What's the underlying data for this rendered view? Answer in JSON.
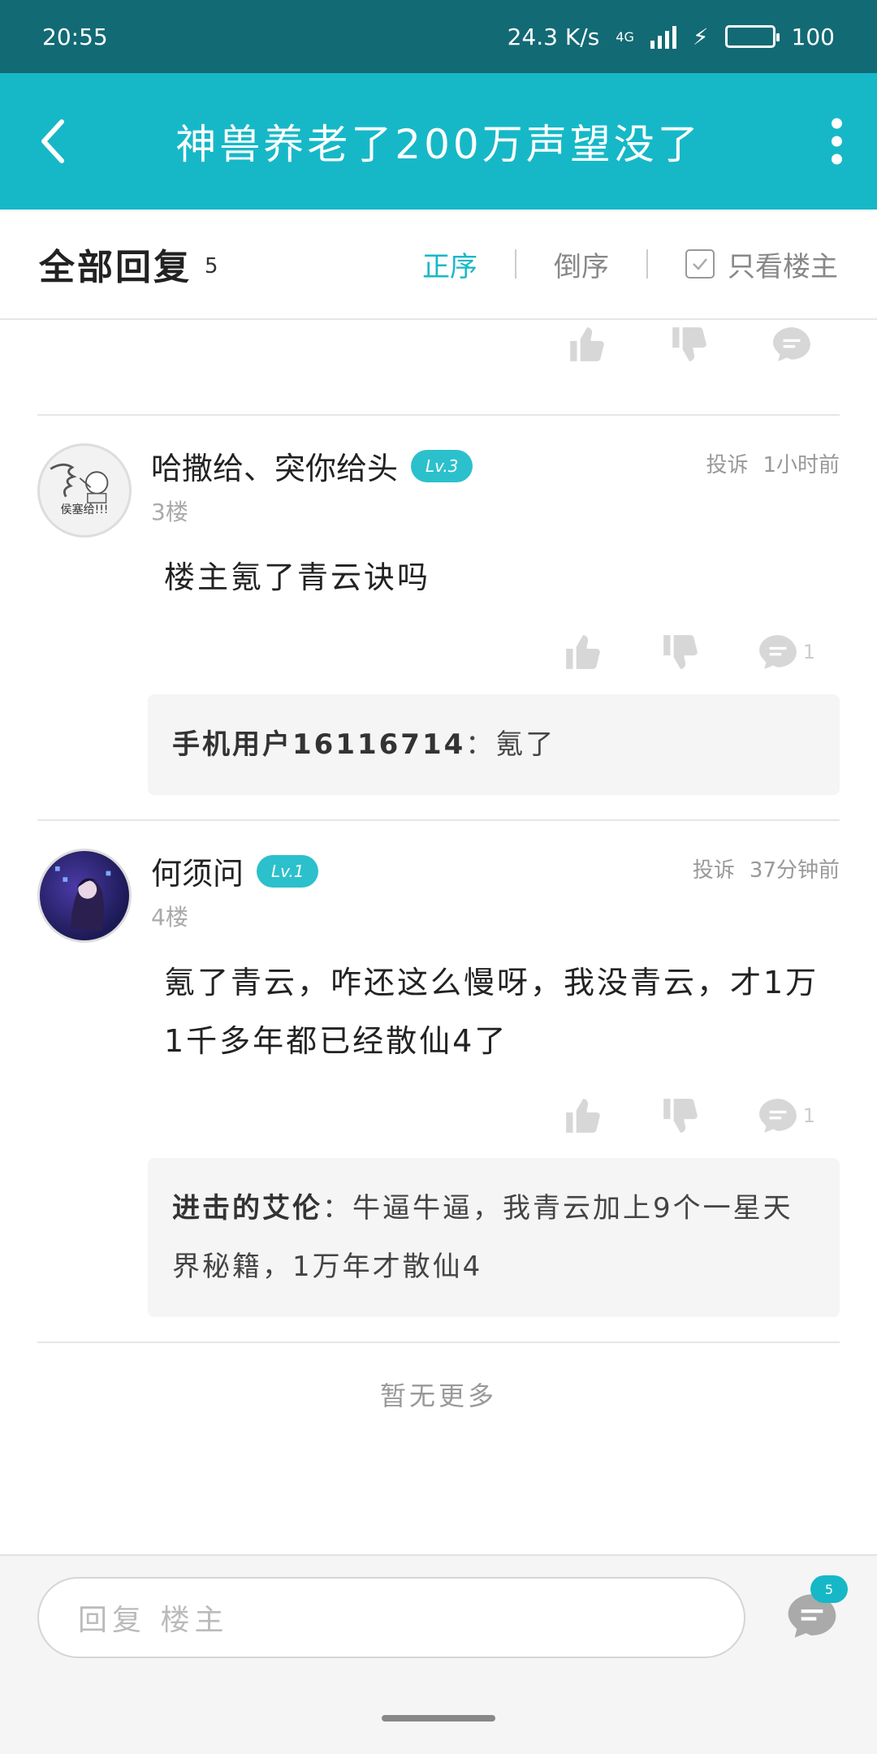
{
  "status_bar": {
    "time": "20:55",
    "net_speed": "24.3 K/s",
    "network": "4G",
    "battery": "100"
  },
  "header": {
    "title": "神兽养老了200万声望没了"
  },
  "filter": {
    "title": "全部回复",
    "count": "5",
    "sort_asc": "正序",
    "sort_desc": "倒序",
    "only_op": "只看楼主"
  },
  "posts": [
    {
      "username": "哈撒给、突你给头",
      "level": "Lv.3",
      "floor": "3楼",
      "report": "投诉",
      "time": "1小时前",
      "avatar_caption": "侯塞给!!!",
      "body": "楼主氪了青云诀吗",
      "comment_count": "1",
      "reply_user": "手机用户16116714",
      "reply_text": "：氪了"
    },
    {
      "username": "何须问",
      "level": "Lv.1",
      "floor": "4楼",
      "report": "投诉",
      "time": "37分钟前",
      "body": "氪了青云，咋还这么慢呀，我没青云，才1万1千多年都已经散仙4了",
      "comment_count": "1",
      "reply_user": "进击的艾伦",
      "reply_text": "：牛逼牛逼，我青云加上9个一星天界秘籍，1万年才散仙4"
    }
  ],
  "footer_text": "暂无更多",
  "bottom": {
    "reply_placeholder": "回复 楼主",
    "comment_badge": "5"
  },
  "colors": {
    "status_bar": "#126a74",
    "accent": "#16b8c7"
  }
}
